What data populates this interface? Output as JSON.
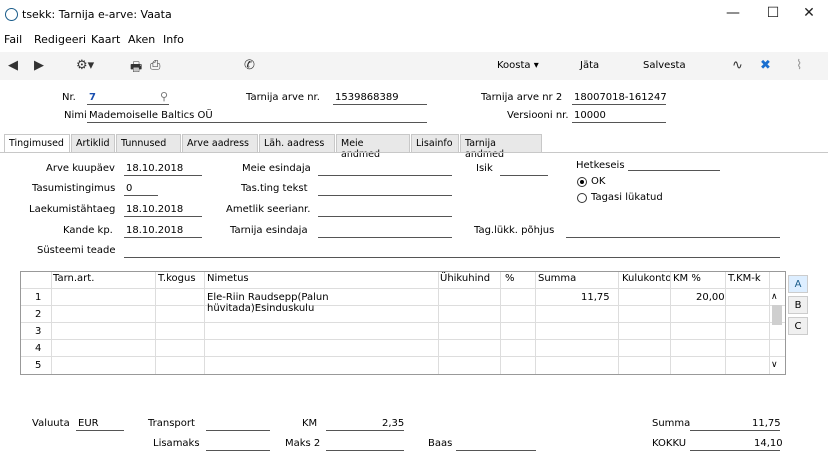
{
  "window": {
    "title": "tsekk: Tarnija e-arve: Vaata",
    "minimize": "—",
    "maximize": "☐",
    "close": "✕"
  },
  "menu": [
    "Fail",
    "Redigeeri",
    "Kaart",
    "Aken",
    "Info"
  ],
  "toolbar": {
    "koosta": "Koosta ▾",
    "jata": "Jäta",
    "salvesta": "Salvesta"
  },
  "header": {
    "nr_label": "Nr.",
    "nr_value": "7",
    "nimi_label": "Nimi",
    "nimi_value": "Mademoiselle Baltics OÜ",
    "tarnija_arve_label": "Tarnija arve nr.",
    "tarnija_arve_value": "1539868389",
    "tarnija_arve2_label": "Tarnija arve nr 2",
    "tarnija_arve2_value": "18007018-161247",
    "versiooni_label": "Versiooni nr.",
    "versiooni_value": "10000"
  },
  "tabs": [
    "Tingimused",
    "Artiklid",
    "Tunnused",
    "Arve aadress",
    "Läh. aadress",
    "Meie andmed",
    "Lisainfo",
    "Tarnija andmed"
  ],
  "form": {
    "arve_kuupaev_label": "Arve kuupäev",
    "arve_kuupaev_value": "18.10.2018",
    "tasumistingimus_label": "Tasumistingimus",
    "tasumistingimus_value": "0",
    "laekumistahtaeg_label": "Laekumistähtaeg",
    "laekumistahtaeg_value": "18.10.2018",
    "kande_kp_label": "Kande kp.",
    "kande_kp_value": "18.10.2018",
    "systeemi_teade_label": "Süsteemi teade",
    "meie_esindaja_label": "Meie esindaja",
    "tas_ting_tekst_label": "Tas.ting tekst",
    "ametlik_seerianr_label": "Ametlik seerianr.",
    "tarnija_esindaja_label": "Tarnija esindaja",
    "isik_label": "Isik",
    "hetkeseis_label": "Hetkeseis",
    "ok_label": "OK",
    "tagasi_lukatud_label": "Tagasi lükatud",
    "tag_lukk_pohjus_label": "Tag.lükk. põhjus"
  },
  "grid": {
    "headers": [
      "Tarn.art.",
      "T.kogus",
      "Nimetus",
      "Ühikuhind",
      "%",
      "Summa",
      "Kulukonto",
      "KM %",
      "T.KM-k"
    ],
    "rows": [
      {
        "n": "1",
        "nimetus": "Ele-Riin Raudsepp(Palun hüvitada)Esinduskulu",
        "summa": "11,75",
        "km": "20,00"
      },
      {
        "n": "2",
        "nimetus": "",
        "summa": "",
        "km": ""
      },
      {
        "n": "3",
        "nimetus": "",
        "summa": "",
        "km": ""
      },
      {
        "n": "4",
        "nimetus": "",
        "summa": "",
        "km": ""
      },
      {
        "n": "5",
        "nimetus": "",
        "summa": "",
        "km": ""
      }
    ],
    "side_tabs": [
      "A",
      "B",
      "C"
    ]
  },
  "footer": {
    "valuuta_label": "Valuuta",
    "valuuta_value": "EUR",
    "transport_label": "Transport",
    "lisamaks_label": "Lisamaks",
    "km_label": "KM",
    "km_value": "2,35",
    "maks2_label": "Maks 2",
    "baas_label": "Baas",
    "summa_label": "Summa",
    "summa_value": "11,75",
    "kokku_label": "KOKKU",
    "kokku_value": "14,10"
  }
}
